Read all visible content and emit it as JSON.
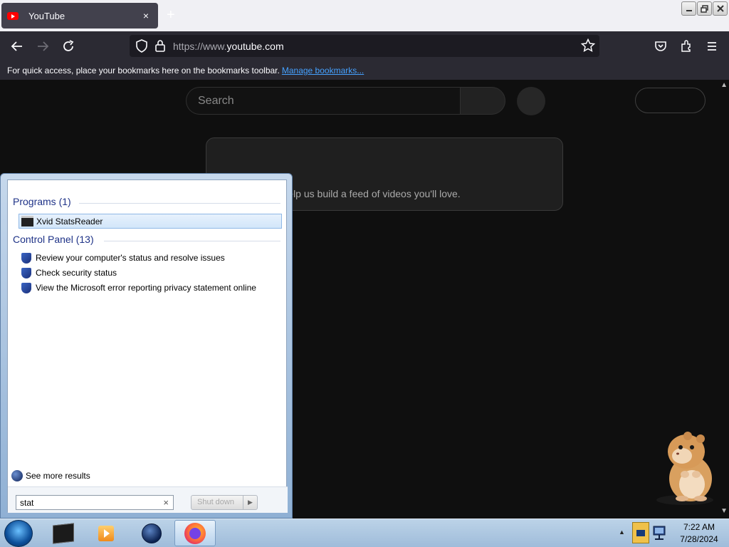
{
  "browser": {
    "tab_title": "YouTube",
    "tab_close": "×",
    "new_tab": "+",
    "url_prefix": "https://www.",
    "url_domain": "youtube.com",
    "bookmarks_message": "For quick access, place your bookmarks here on the bookmarks toolbar.",
    "manage_bookmarks_link": "Manage bookmarks..."
  },
  "youtube": {
    "search_placeholder": "Search",
    "card_text": "ing videos to help us build a feed of videos you'll love."
  },
  "start_menu": {
    "programs_header": "Programs (1)",
    "program_item": "Xvid StatsReader",
    "control_panel_header": "Control Panel (13)",
    "control_panel_items": [
      "Review your computer's status and resolve issues",
      "Check security status",
      "View the Microsoft error reporting privacy statement online"
    ],
    "see_more": "See more results",
    "search_value": "stat",
    "search_clear": "×",
    "shutdown_label": "Shut down"
  },
  "taskbar": {
    "time": "7:22 AM",
    "date": "7/28/2024"
  },
  "icons": [
    "youtube-icon",
    "back-icon",
    "forward-icon",
    "reload-icon",
    "shield-icon",
    "lock-icon",
    "star-icon",
    "pocket-icon",
    "extensions-icon",
    "menu-icon",
    "start-orb-icon",
    "cmd-icon",
    "media-player-icon",
    "globe-icon",
    "firefox-icon"
  ],
  "colors": {
    "accent": "#45a1ff",
    "youtube_red": "#ff0000",
    "page_bg": "#0f0f0f"
  }
}
